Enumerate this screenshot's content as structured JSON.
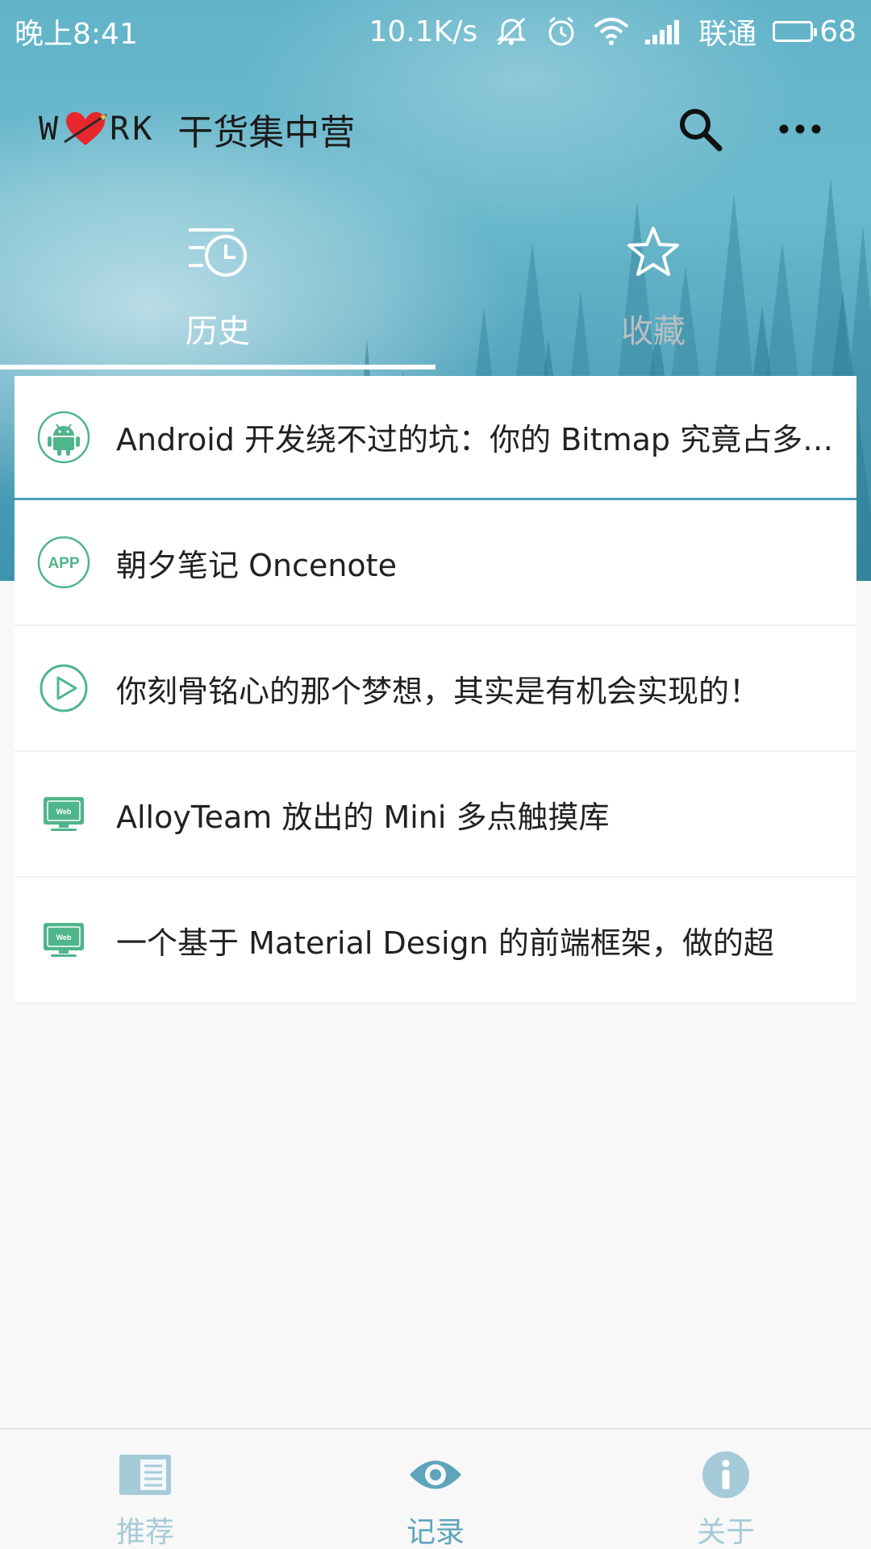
{
  "status_bar": {
    "time": "晚上8:41",
    "net_speed": "10.1K/s",
    "carrier": "联通",
    "battery_level": "68"
  },
  "toolbar": {
    "logo_letters": [
      "W",
      "R",
      "K"
    ],
    "app_title": "干货集中营"
  },
  "tabs": [
    {
      "label": "历史",
      "icon": "history-icon",
      "active": true
    },
    {
      "label": "收藏",
      "icon": "star-icon",
      "active": false
    }
  ],
  "list": {
    "items": [
      {
        "icon": "android-icon",
        "title": "Android 开发绕不过的坑：你的 Bitmap 究竟占多大内存？"
      },
      {
        "icon": "app-icon",
        "title": "朝夕笔记 Oncenote"
      },
      {
        "icon": "play-video-icon",
        "title": "你刻骨铭心的那个梦想，其实是有机会实现的！"
      },
      {
        "icon": "web-icon",
        "title": "AlloyTeam 放出的 Mini 多点触摸库"
      },
      {
        "icon": "web-icon",
        "title": "一个基于 Material Design 的前端框架，做的超"
      }
    ]
  },
  "bottom_nav": [
    {
      "label": "推荐",
      "icon": "recommend-book-icon",
      "active": false
    },
    {
      "label": "记录",
      "icon": "eye-icon",
      "active": true
    },
    {
      "label": "关于",
      "icon": "info-icon",
      "active": false
    }
  ],
  "colors": {
    "accent": "#4fb58a",
    "header_teal": "#62b3c8",
    "nav_active": "#5ea4bb",
    "nav_inactive": "#a6cbd8"
  }
}
